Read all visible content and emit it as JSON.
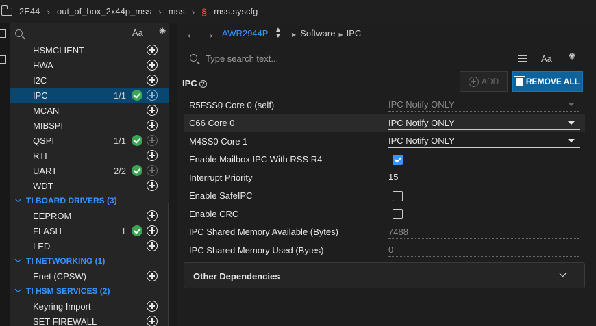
{
  "breadcrumb": {
    "items": [
      "2E44",
      "out_of_box_2x44p_mss",
      "mss",
      "mss.syscfg"
    ]
  },
  "sidebar": {
    "aa_label": "Aa",
    "star_label": "⁕",
    "items": [
      {
        "type": "item",
        "label": "HSMCLIENT",
        "count": "",
        "status": "none"
      },
      {
        "type": "item",
        "label": "HWA",
        "count": "",
        "status": "none"
      },
      {
        "type": "item",
        "label": "I2C",
        "count": "",
        "status": "none"
      },
      {
        "type": "item",
        "label": "IPC",
        "count": "1/1",
        "status": "ok",
        "selected": true
      },
      {
        "type": "item",
        "label": "MCAN",
        "count": "",
        "status": "none"
      },
      {
        "type": "item",
        "label": "MIBSPI",
        "count": "",
        "status": "none"
      },
      {
        "type": "item",
        "label": "QSPI",
        "count": "1/1",
        "status": "ok"
      },
      {
        "type": "item",
        "label": "RTI",
        "count": "",
        "status": "none"
      },
      {
        "type": "item",
        "label": "UART",
        "count": "2/2",
        "status": "ok"
      },
      {
        "type": "item",
        "label": "WDT",
        "count": "",
        "status": "none"
      },
      {
        "type": "group",
        "label": "TI BOARD DRIVERS (3)"
      },
      {
        "type": "item",
        "label": "EEPROM",
        "count": "",
        "status": "none"
      },
      {
        "type": "item",
        "label": "FLASH",
        "count": "1",
        "status": "ok"
      },
      {
        "type": "item",
        "label": "LED",
        "count": "",
        "status": "none"
      },
      {
        "type": "group",
        "label": "TI NETWORKING (1)"
      },
      {
        "type": "item",
        "label": "Enet (CPSW)",
        "count": "",
        "status": "none"
      },
      {
        "type": "group",
        "label": "TI HSM SERVICES (2)"
      },
      {
        "type": "item",
        "label": "Keyring Import",
        "count": "",
        "status": "none"
      },
      {
        "type": "item",
        "label": "SET FIREWALL",
        "count": "",
        "status": "none"
      }
    ]
  },
  "nav": {
    "back": "←",
    "forward": "→",
    "device": "AWR2944P",
    "path": [
      "Software",
      "IPC"
    ]
  },
  "search": {
    "placeholder": "Type search text...",
    "aa_label": "Aa",
    "star_label": "⁕"
  },
  "panel": {
    "title": "IPC",
    "help_label": "?",
    "add_label": "ADD",
    "remove_label": "REMOVE ALL",
    "rows": [
      {
        "label": "R5FSS0 Core 0 (self)",
        "kind": "select",
        "value": "IPC Notify ONLY",
        "disabled": true
      },
      {
        "label": "C66 Core 0",
        "kind": "select",
        "value": "IPC Notify ONLY",
        "highlight": true
      },
      {
        "label": "M4SS0 Core 1",
        "kind": "select",
        "value": "IPC Notify ONLY"
      },
      {
        "label": "Enable Mailbox IPC With RSS R4",
        "kind": "checkbox",
        "checked": true
      },
      {
        "label": "Interrupt Priority",
        "kind": "text",
        "value": "15"
      },
      {
        "label": "Enable SafeIPC",
        "kind": "checkbox",
        "checked": false
      },
      {
        "label": "Enable CRC",
        "kind": "checkbox",
        "checked": false
      },
      {
        "label": "IPC Shared Memory Available (Bytes)",
        "kind": "readonly",
        "value": "7488"
      },
      {
        "label": "IPC Shared Memory Used (Bytes)",
        "kind": "readonly",
        "value": "0"
      }
    ],
    "other_dependencies": "Other Dependencies"
  },
  "colors": {
    "accent": "#3794ff",
    "selected": "#094771",
    "ok": "#3aa655",
    "button": "#0e639c"
  }
}
